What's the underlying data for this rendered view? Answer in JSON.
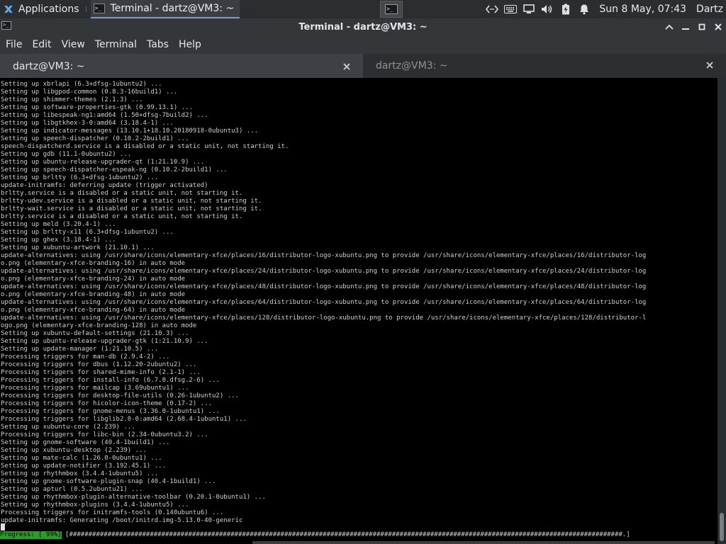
{
  "panel": {
    "applications_label": "Applications",
    "task_label": "Terminal - dartz@VM3: ~",
    "clock": "Sun  8 May, 07:43",
    "user": "Dartz"
  },
  "window": {
    "title": "Terminal - dartz@VM3: ~"
  },
  "menu": {
    "items": [
      "File",
      "Edit",
      "View",
      "Terminal",
      "Tabs",
      "Help"
    ]
  },
  "tabs": [
    {
      "label": "dartz@VM3: ~"
    },
    {
      "label": "dartz@VM3: ~"
    }
  ],
  "terminal": {
    "lines": [
      "Setting up xbrlapi (6.3+dfsg-1ubuntu2) ...",
      "Setting up libgpod-common (0.8.3-16build1) ...",
      "Setting up shimmer-themes (2.1.3) ...",
      "Setting up software-properties-gtk (0.99.13.1) ...",
      "Setting up libespeak-ng1:amd64 (1.50+dfsg-7build2) ...",
      "Setting up libgtkhex-3-0:amd64 (3.18.4-1) ...",
      "Setting up indicator-messages (13.10.1+18.10.20180918-0ubuntu3) ...",
      "Setting up speech-dispatcher (0.10.2-2build1) ...",
      "speech-dispatcherd.service is a disabled or a static unit, not starting it.",
      "Setting up gdb (11.1-0ubuntu2) ...",
      "Setting up ubuntu-release-upgrader-qt (1:21.10.9) ...",
      "Setting up speech-dispatcher-espeak-ng (0.10.2-2build1) ...",
      "Setting up brltty (6.3+dfsg-1ubuntu2) ...",
      "update-initramfs: deferring update (trigger activated)",
      "brltty.service is a disabled or a static unit, not starting it.",
      "brltty-udev.service is a disabled or a static unit, not starting it.",
      "brltty-wait.service is a disabled or a static unit, not starting it.",
      "brltty.service is a disabled or a static unit, not starting it.",
      "Setting up meld (3.20.4-1) ...",
      "Setting up brltty-x11 (6.3+dfsg-1ubuntu2) ...",
      "Setting up ghex (3.18.4-1) ...",
      "Setting up xubuntu-artwork (21.10.1) ...",
      "update-alternatives: using /usr/share/icons/elementary-xfce/places/16/distributor-logo-xubuntu.png to provide /usr/share/icons/elementary-xfce/places/16/distributor-log",
      "o.png (elementary-xfce-branding-16) in auto mode",
      "update-alternatives: using /usr/share/icons/elementary-xfce/places/24/distributor-logo-xubuntu.png to provide /usr/share/icons/elementary-xfce/places/24/distributor-log",
      "o.png (elementary-xfce-branding-24) in auto mode",
      "update-alternatives: using /usr/share/icons/elementary-xfce/places/48/distributor-logo-xubuntu.png to provide /usr/share/icons/elementary-xfce/places/48/distributor-log",
      "o.png (elementary-xfce-branding-48) in auto mode",
      "update-alternatives: using /usr/share/icons/elementary-xfce/places/64/distributor-logo-xubuntu.png to provide /usr/share/icons/elementary-xfce/places/64/distributor-log",
      "o.png (elementary-xfce-branding-64) in auto mode",
      "update-alternatives: using /usr/share/icons/elementary-xfce/places/128/distributor-logo-xubuntu.png to provide /usr/share/icons/elementary-xfce/places/128/distributor-l",
      "ogo.png (elementary-xfce-branding-128) in auto mode",
      "Setting up xubuntu-default-settings (21.10.3) ...",
      "Setting up ubuntu-release-upgrader-gtk (1:21.10.9) ...",
      "Setting up update-manager (1:21.10.5) ...",
      "Processing triggers for man-db (2.9.4-2) ...",
      "Processing triggers for dbus (1.12.20-2ubuntu2) ...",
      "Processing triggers for shared-mime-info (2.1-1) ...",
      "Processing triggers for install-info (6.7.0.dfsg.2-6) ...",
      "Processing triggers for mailcap (3.69ubuntu1) ...",
      "Processing triggers for desktop-file-utils (0.26-1ubuntu2) ...",
      "Processing triggers for hicolor-icon-theme (0.17-2) ...",
      "Processing triggers for gnome-menus (3.36.0-1ubuntu1) ...",
      "Processing triggers for libglib2.0-0:amd64 (2.68.4-1ubuntu1) ...",
      "Setting up xubuntu-core (2.239) ...",
      "Processing triggers for libc-bin (2.34-0ubuntu3.2) ...",
      "Setting up gnome-software (40.4-1build1) ...",
      "Setting up xubuntu-desktop (2.239) ...",
      "Setting up mate-calc (1.26.0-0ubuntu1) ...",
      "Setting up update-notifier (3.192.45.1) ...",
      "Setting up rhythmbox (3.4.4-1ubuntu5) ...",
      "Setting up gnome-software-plugin-snap (40.4-1build1) ...",
      "Setting up apturl (0.5.2ubuntu21) ...",
      "Setting up rhythmbox-plugin-alternative-toolbar (0.20.1-0ubuntu1) ...",
      "Setting up rhythmbox-plugins (3.4.4-1ubuntu5) ...",
      "Processing triggers for initramfs-tools (0.140ubuntu6) ...",
      "update-initramfs: Generating /boot/initrd.img-5.13.0-40-generic"
    ],
    "progress_label": "Progress: [ 99%]",
    "progress_bar": " [################################################################################################################################################.] ",
    "progress_percent": 99
  },
  "icons": {
    "xfce": "xfce-mouse-icon",
    "terminal": "terminal-icon",
    "code": "code-brackets-icon",
    "keyboard": "keyboard-icon",
    "display": "display-icon",
    "volume": "volume-icon",
    "battery": "battery-icon",
    "notifications": "bell-icon"
  },
  "colors": {
    "terminal_bg": "#000000",
    "progress_green": "#2e9a2e",
    "panel_bg": "#2b2e31"
  }
}
